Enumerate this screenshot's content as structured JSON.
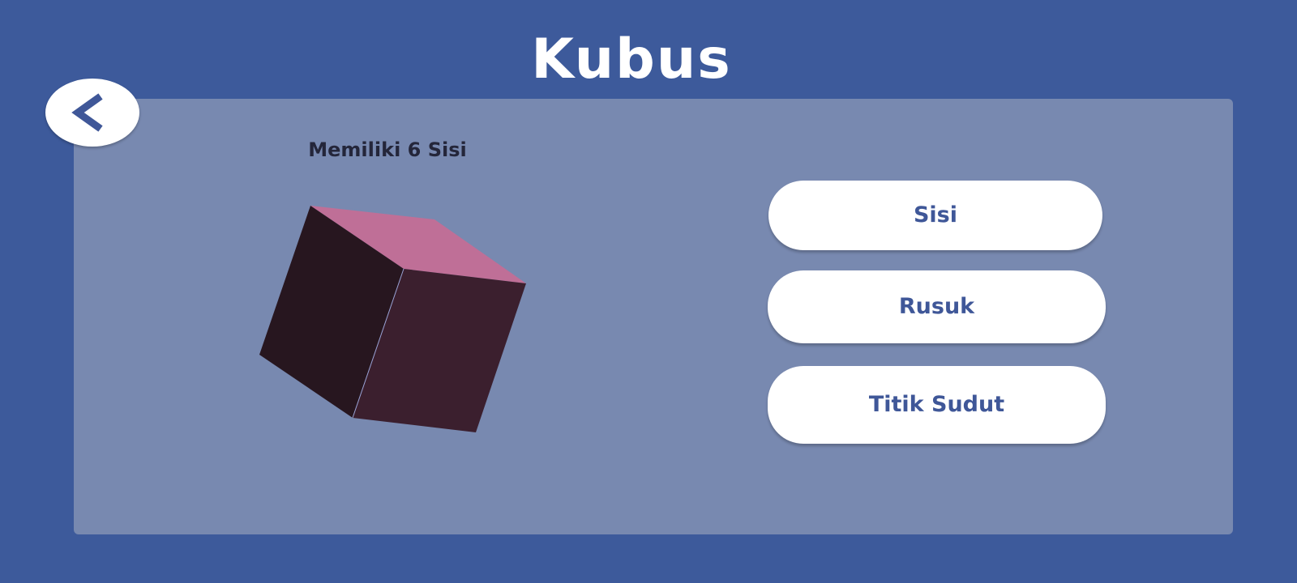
{
  "header": {
    "title": "Kubus"
  },
  "back_button": {
    "icon": "chevron-left-icon"
  },
  "content": {
    "caption": "Memiliki 6 Sisi",
    "model": "cube"
  },
  "menu": {
    "buttons": [
      {
        "label": "Sisi"
      },
      {
        "label": "Rusuk"
      },
      {
        "label": "Titik Sudut"
      }
    ]
  },
  "colors": {
    "background": "#3d5a9b",
    "panel": "#7889b0",
    "button": "#ffffff",
    "button_text": "#3f5798",
    "cube_top": "#bf6f97",
    "cube_left": "#27161f",
    "cube_right": "#3b1f2e"
  }
}
